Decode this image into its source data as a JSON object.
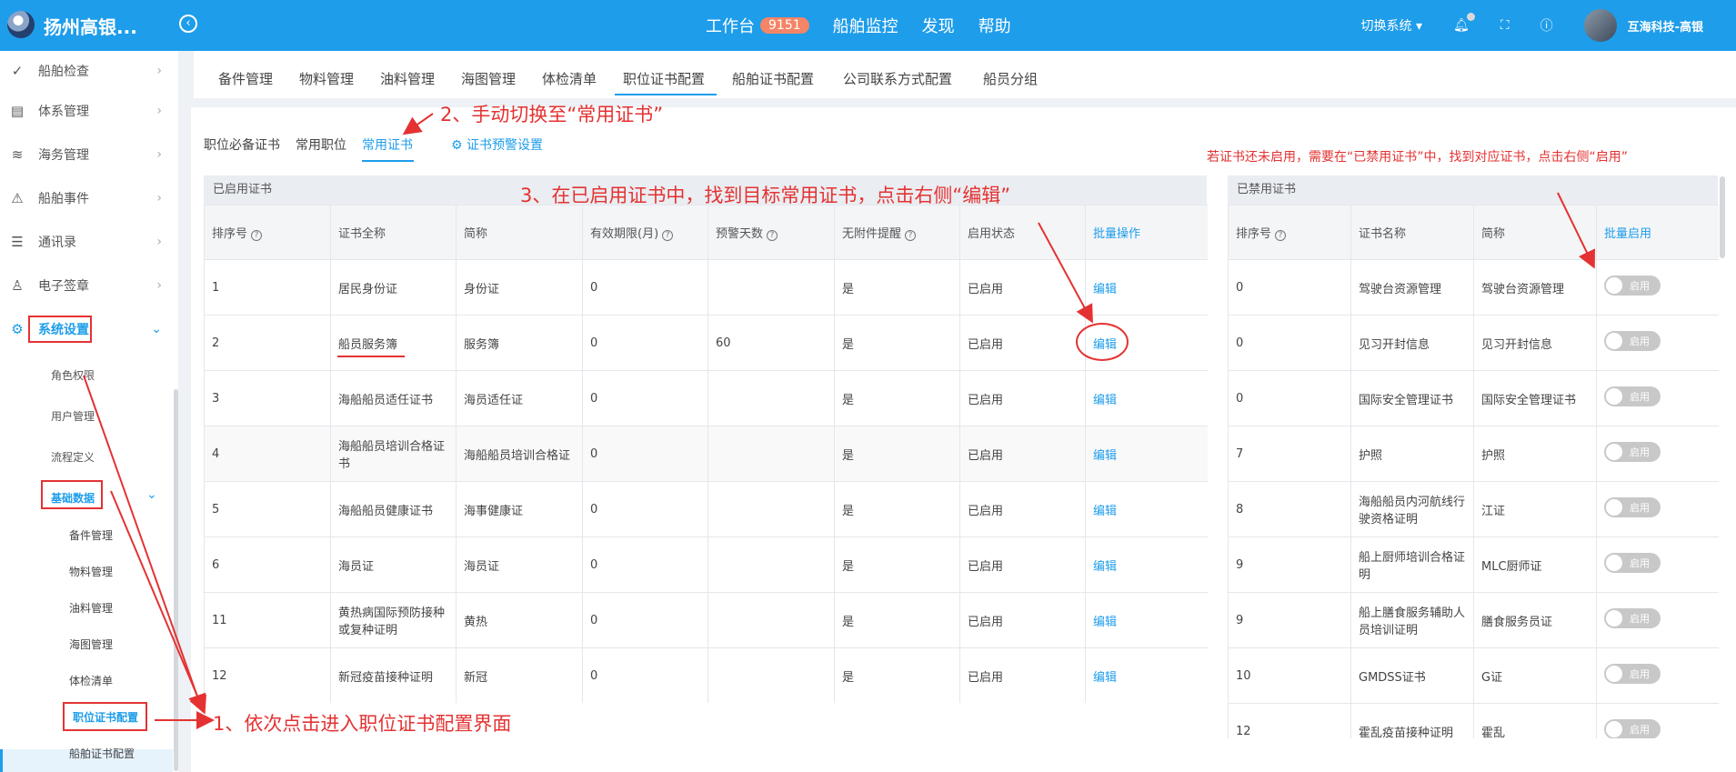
{
  "app": {
    "title": "扬州高银...",
    "back_icon": "circle-left-arrow-icon"
  },
  "topnav": {
    "workbench": "工作台",
    "badge": "9151",
    "monitor": "船舶监控",
    "discover": "发现",
    "help": "帮助"
  },
  "topright": {
    "switch_system": "切换系统",
    "user": "互海科技-高银"
  },
  "sidebar": {
    "items": [
      {
        "label": "船舶检查",
        "icon": "check-circle-icon"
      },
      {
        "label": "体系管理",
        "icon": "document-icon"
      },
      {
        "label": "海务管理",
        "icon": "sea-icon"
      },
      {
        "label": "船舶事件",
        "icon": "warning-icon"
      },
      {
        "label": "通讯录",
        "icon": "contacts-icon"
      },
      {
        "label": "电子签章",
        "icon": "stamp-icon"
      },
      {
        "label": "系统设置",
        "icon": "gear-icon"
      }
    ],
    "system_children": [
      "角色权限",
      "用户管理",
      "流程定义"
    ],
    "basic_data": "基础数据",
    "basic_children": [
      "备件管理",
      "物料管理",
      "油料管理",
      "海图管理",
      "体检清单",
      "职位证书配置",
      "船舶证书配置"
    ]
  },
  "tabs": [
    "备件管理",
    "物料管理",
    "油料管理",
    "海图管理",
    "体检清单",
    "职位证书配置",
    "船舶证书配置",
    "公司联系方式配置",
    "船员分组"
  ],
  "subtabs": {
    "required": "职位必备证书",
    "common_position": "常用职位",
    "common_cert": "常用证书",
    "warning_settings": "证书预警设置"
  },
  "enabled_table": {
    "title": "已启用证书",
    "headers": [
      "排序号",
      "证书全称",
      "简称",
      "有效期限(月)",
      "预警天数",
      "无附件提醒",
      "启用状态",
      "批量操作"
    ],
    "rows": [
      {
        "order": "1",
        "name": "居民身份证",
        "short": "身份证",
        "months": "0",
        "warn": "",
        "remind": "是",
        "status": "已启用",
        "action": "编辑"
      },
      {
        "order": "2",
        "name": "船员服务簿",
        "short": "服务簿",
        "months": "0",
        "warn": "60",
        "remind": "是",
        "status": "已启用",
        "action": "编辑"
      },
      {
        "order": "3",
        "name": "海船船员适任证书",
        "short": "海员适任证",
        "months": "0",
        "warn": "",
        "remind": "是",
        "status": "已启用",
        "action": "编辑"
      },
      {
        "order": "4",
        "name": "海船船员培训合格证书",
        "short": "海船船员培训合格证",
        "months": "0",
        "warn": "",
        "remind": "是",
        "status": "已启用",
        "action": "编辑"
      },
      {
        "order": "5",
        "name": "海船船员健康证书",
        "short": "海事健康证",
        "months": "0",
        "warn": "",
        "remind": "是",
        "status": "已启用",
        "action": "编辑"
      },
      {
        "order": "6",
        "name": "海员证",
        "short": "海员证",
        "months": "0",
        "warn": "",
        "remind": "是",
        "status": "已启用",
        "action": "编辑"
      },
      {
        "order": "11",
        "name": "黄热病国际预防接种或复种证明",
        "short": "黄热",
        "months": "0",
        "warn": "",
        "remind": "是",
        "status": "已启用",
        "action": "编辑"
      },
      {
        "order": "12",
        "name": "新冠疫苗接种证明",
        "short": "新冠",
        "months": "0",
        "warn": "",
        "remind": "是",
        "status": "已启用",
        "action": "编辑"
      }
    ]
  },
  "disabled_table": {
    "title": "已禁用证书",
    "headers": [
      "排序号",
      "证书名称",
      "简称",
      "批量启用"
    ],
    "toggle_label": "启用",
    "rows": [
      {
        "order": "0",
        "name": "驾驶台资源管理",
        "short": "驾驶台资源管理"
      },
      {
        "order": "0",
        "name": "见习开封信息",
        "short": "见习开封信息"
      },
      {
        "order": "0",
        "name": "国际安全管理证书",
        "short": "国际安全管理证书"
      },
      {
        "order": "7",
        "name": "护照",
        "short": "护照"
      },
      {
        "order": "8",
        "name": "海船船员内河航线行驶资格证明",
        "short": "江证"
      },
      {
        "order": "9",
        "name": "船上厨师培训合格证明",
        "short": "MLC厨师证"
      },
      {
        "order": "9",
        "name": "船上膳食服务辅助人员培训证明",
        "short": "膳食服务员证"
      },
      {
        "order": "10",
        "name": "GMDSS证书",
        "short": "G证"
      },
      {
        "order": "12",
        "name": "霍乱疫苗接种证明",
        "short": "霍乱"
      }
    ]
  },
  "annotations": {
    "step1": "1、依次点击进入职位证书配置界面",
    "step2": "2、手动切换至“常用证书”",
    "step3": "3、在已启用证书中，找到目标常用证书，点击右侧“编辑”",
    "note": "若证书还未启用，需要在“已禁用证书”中，找到对应证书，点击右侧“启用”"
  }
}
